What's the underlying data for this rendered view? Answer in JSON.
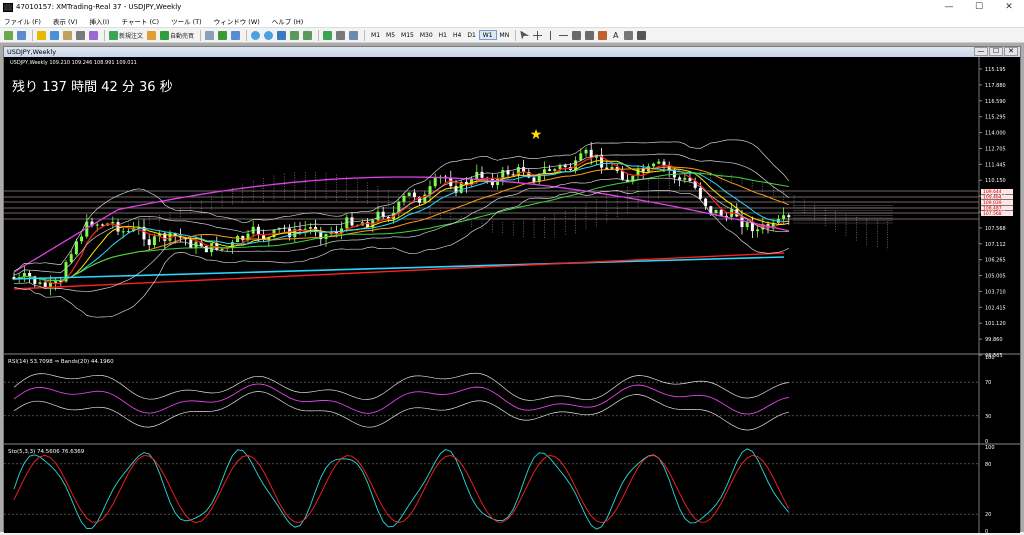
{
  "window": {
    "title": "47010157: XMTrading-Real 37 - USDJPY,Weekly",
    "min": "—",
    "max": "☐",
    "close": "✕"
  },
  "menu": [
    "ファイル (F)",
    "表示 (V)",
    "挿入(I)",
    "チャート (C)",
    "ツール (T)",
    "ウィンドウ (W)",
    "ヘルプ (H)"
  ],
  "toolbar": {
    "new_order": "新規注文",
    "auto_trade": "自動売買",
    "timeframes": [
      "M1",
      "M5",
      "M15",
      "M30",
      "H1",
      "H4",
      "D1",
      "W1",
      "MN"
    ],
    "active_timeframe": "W1"
  },
  "chart": {
    "title": "USDJPY,Weekly",
    "header_info": "USDJPY,Weekly  109.210 109.246 108.991 109.011",
    "countdown": "残り 137 時間 42 分 36 秒",
    "price_labels": [
      "115.195",
      "117.880",
      "116.590",
      "115.295",
      "114.000",
      "112.705",
      "111.445",
      "110.150",
      "109.464",
      "108.400",
      "107.568",
      "107.112",
      "106.265",
      "105.005",
      "103.710",
      "102.415",
      "101.120",
      "99.860",
      "98.565"
    ],
    "highlight_labels": [
      "109.644",
      "109.464",
      "109.039",
      "108.487",
      "107.568"
    ],
    "rsi_label": "RSI(14) 53.7098  ⇒ Bands(20) 44.1960",
    "rsi_levels": [
      "100",
      "70",
      "30",
      "0"
    ],
    "stoch_label": "Sto(5,3,3) 74.5606 76.6369",
    "stoch_levels": [
      "100",
      "80",
      "20",
      "0"
    ],
    "star_icon": "★"
  },
  "colors": {
    "bull": "#7dff4a",
    "bear": "#ffffff",
    "ma_red": "#ff2020",
    "ma_cyan": "#2ad8ff",
    "ma_yellow": "#ffe600",
    "ma_orange": "#ff9a1a",
    "ma_magenta": "#e040e8",
    "ma_green": "#3cd63c",
    "bands": "#d0d0d0"
  }
}
